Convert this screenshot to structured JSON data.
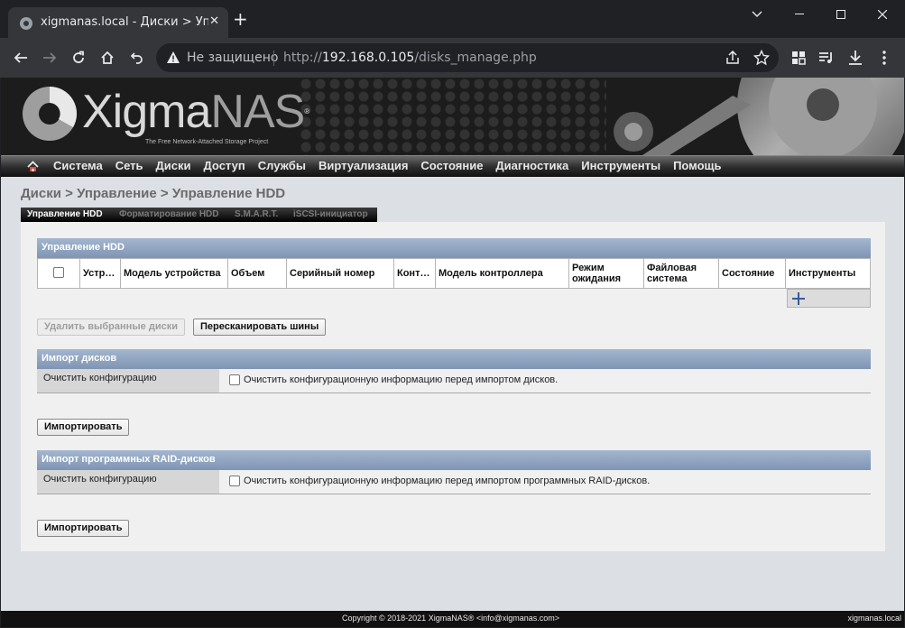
{
  "browser": {
    "tab_title": "xigmanas.local - Диски > Управление",
    "not_secure": "Не защищено",
    "url_prefix": "http://",
    "url_host": "192.168.0.105",
    "url_path": "/disks_manage.php"
  },
  "header": {
    "logo_main": "Xigma",
    "logo_nas": "NAS",
    "logo_reg": "®",
    "tagline": "The Free Network-Attached Storage Project"
  },
  "menu": [
    "Система",
    "Сеть",
    "Диски",
    "Доступ",
    "Службы",
    "Виртуализация",
    "Состояние",
    "Диагностика",
    "Инструменты",
    "Помощь"
  ],
  "breadcrumb": "Диски > Управление > Управление HDD",
  "subtabs": {
    "active": "Управление HDD",
    "format": "Форматирование HDD",
    "smart": "S.M.A.R.T.",
    "iscsi": "iSCSI-инициатор"
  },
  "hdd_section": {
    "title": "Управление HDD",
    "columns": [
      "Устр…",
      "Модель устройства",
      "Объем",
      "Серийный номер",
      "Конт…",
      "Модель контроллера",
      "Режим ожидания",
      "Файловая система",
      "Состояние",
      "Инструменты"
    ],
    "delete_button": "Удалить выбранные диски",
    "rescan_button": "Пересканировать шины"
  },
  "import_disks": {
    "title": "Импорт дисков",
    "label": "Очистить конфигурацию",
    "checkbox_text": "Очистить конфигурационную информацию перед импортом дисков.",
    "button": "Импортировать"
  },
  "import_raid": {
    "title": "Импорт программных RAID-дисков",
    "label": "Очистить конфигурацию",
    "checkbox_text": "Очистить конфигурационную информацию перед импортом программных RAID-дисков.",
    "button": "Импортировать"
  },
  "footer": {
    "copyright": "Copyright © 2018-2021 XigmaNAS® <info@xigmanas.com>",
    "host": "xigmanas.local"
  },
  "colors": {
    "section_header": "#8ea3c1",
    "accent_plus": "#3b5998"
  }
}
